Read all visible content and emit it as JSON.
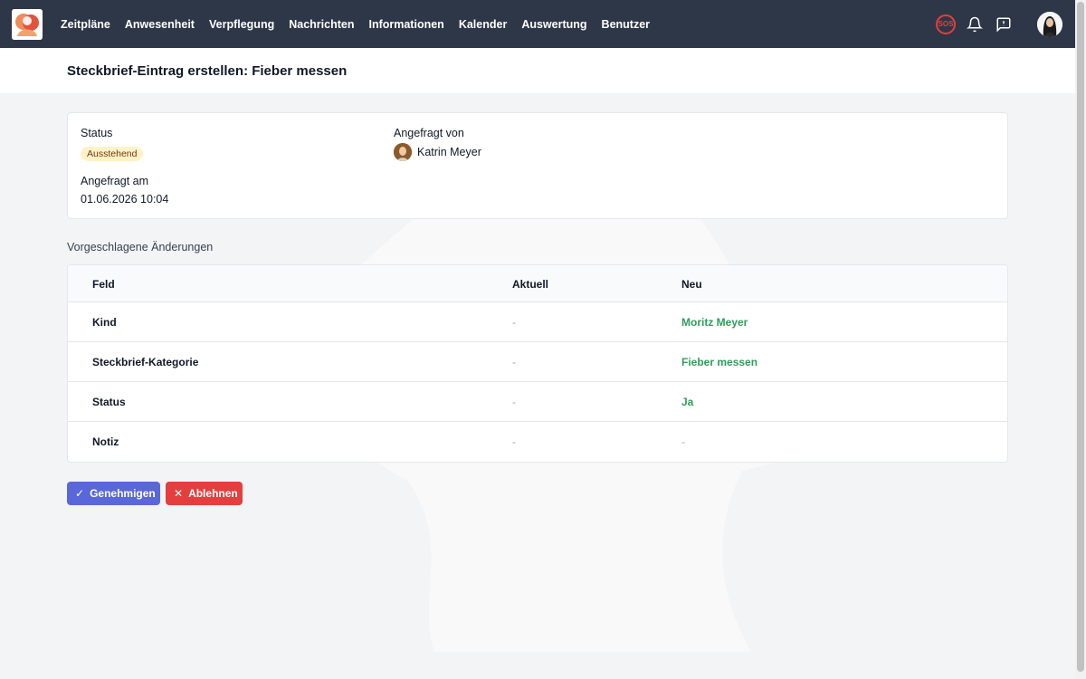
{
  "nav": {
    "items": [
      "Zeitpläne",
      "Anwesenheit",
      "Verpflegung",
      "Nachrichten",
      "Informationen",
      "Kalender",
      "Auswertung",
      "Benutzer"
    ],
    "sos_label": "SOS",
    "icons": [
      "app-logo",
      "sos-icon",
      "bell-icon",
      "chat-icon",
      "user-avatar"
    ]
  },
  "page": {
    "title": "Steckbrief-Eintrag erstellen: Fieber messen"
  },
  "request": {
    "status_label": "Status",
    "status_value": "Ausstehend",
    "requested_at_label": "Angefragt am",
    "requested_at_value": "01.06.2026 10:04",
    "requested_by_label": "Angefragt von",
    "requested_by_value": "Katrin Meyer"
  },
  "changes": {
    "heading": "Vorgeschlagene Änderungen",
    "columns": [
      "Feld",
      "Aktuell",
      "Neu"
    ],
    "rows": [
      {
        "field": "Kind",
        "current": "-",
        "new": "Moritz Meyer"
      },
      {
        "field": "Steckbrief-Kategorie",
        "current": "-",
        "new": "Fieber messen"
      },
      {
        "field": "Status",
        "current": "-",
        "new": "Ja"
      },
      {
        "field": "Notiz",
        "current": "-",
        "new": "-"
      }
    ]
  },
  "actions": {
    "approve_label": "Genehmigen",
    "reject_label": "Ablehnen"
  },
  "colors": {
    "nav_bg": "#2d3748",
    "approve": "#5a67d8",
    "reject": "#e53e3e",
    "new_value": "#2f9e5a",
    "badge_bg": "#fef3c7"
  }
}
